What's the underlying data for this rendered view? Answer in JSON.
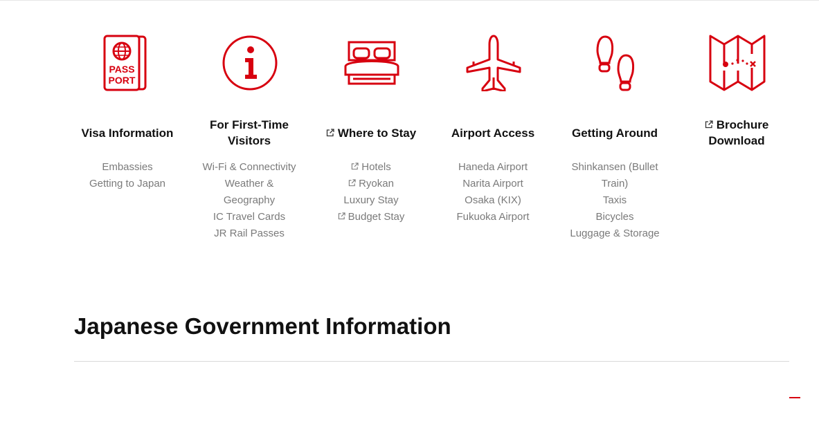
{
  "theme": {
    "accent": "#d7000f",
    "link_color": "#7a7a7a"
  },
  "columns": [
    {
      "icon": "passport-icon",
      "icon_text_1": "PASS",
      "icon_text_2": "PORT",
      "heading": "Visa Information",
      "heading_external": false,
      "links": [
        {
          "label": "Embassies",
          "external": false
        },
        {
          "label": "Getting to Japan",
          "external": false
        }
      ]
    },
    {
      "icon": "info-icon",
      "heading": "For First-Time Visitors",
      "heading_external": false,
      "links": [
        {
          "label": "Wi-Fi & Connectivity",
          "external": false
        },
        {
          "label": "Weather & Geography",
          "external": false
        },
        {
          "label": "IC Travel Cards",
          "external": false
        },
        {
          "label": "JR Rail Passes",
          "external": false
        }
      ]
    },
    {
      "icon": "bed-icon",
      "heading": "Where to Stay",
      "heading_external": true,
      "links": [
        {
          "label": "Hotels",
          "external": true
        },
        {
          "label": "Ryokan",
          "external": true
        },
        {
          "label": "Luxury Stay",
          "external": false
        },
        {
          "label": "Budget Stay",
          "external": true
        }
      ]
    },
    {
      "icon": "airplane-icon",
      "heading": "Airport Access",
      "heading_external": false,
      "links": [
        {
          "label": "Haneda Airport",
          "external": false
        },
        {
          "label": "Narita Airport",
          "external": false
        },
        {
          "label": "Osaka (KIX)",
          "external": false
        },
        {
          "label": "Fukuoka Airport",
          "external": false
        }
      ]
    },
    {
      "icon": "footprints-icon",
      "heading": "Getting Around",
      "heading_external": false,
      "links": [
        {
          "label": "Shinkansen (Bullet Train)",
          "external": false
        },
        {
          "label": "Taxis",
          "external": false
        },
        {
          "label": "Bicycles",
          "external": false
        },
        {
          "label": "Luggage & Storage",
          "external": false
        }
      ]
    },
    {
      "icon": "map-icon",
      "heading": "Brochure Download",
      "heading_external": true,
      "links": []
    }
  ],
  "section_title": "Japanese Government Information"
}
